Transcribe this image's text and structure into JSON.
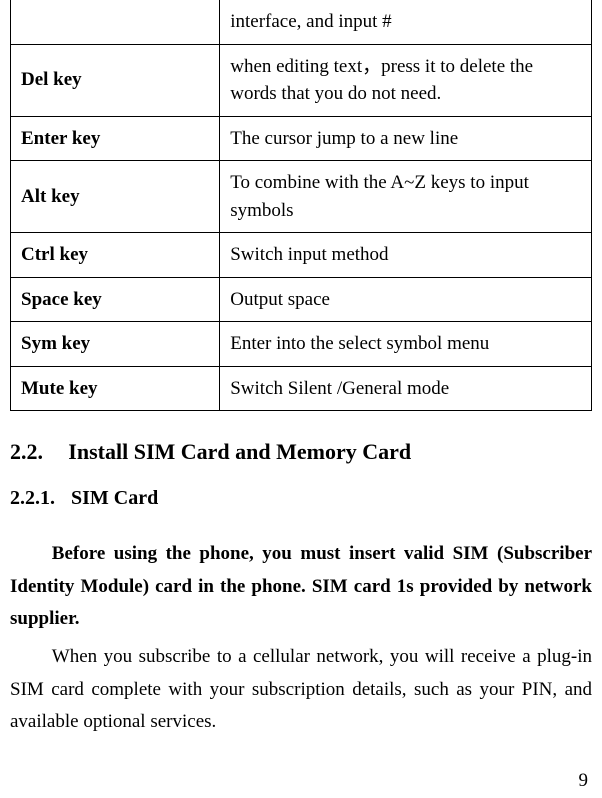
{
  "table": {
    "rows": [
      {
        "key": "",
        "desc": "interface, and input #"
      },
      {
        "key": "Del key",
        "desc": "when editing text，press it to delete the words that you do not need."
      },
      {
        "key": "Enter key",
        "desc": "The cursor jump to a new line"
      },
      {
        "key": "Alt key",
        "desc": "To combine with the A~Z keys to input symbols"
      },
      {
        "key": "Ctrl key",
        "desc": "Switch input method"
      },
      {
        "key": "Space key",
        "desc": "Output space"
      },
      {
        "key": "Sym key",
        "desc": "Enter into the select symbol menu"
      },
      {
        "key": "Mute key",
        "desc": "Switch Silent /General mode"
      }
    ]
  },
  "headings": {
    "h2_num": "2.2.",
    "h2_text": "Install SIM Card and Memory Card",
    "h3_num": "2.2.1.",
    "h3_text": "SIM Card"
  },
  "paragraphs": {
    "p1": "Before using the phone, you must insert valid SIM (Subscriber Identity Module) card in the phone. SIM card 1s provided by network supplier.",
    "p2": "When you subscribe to a cellular network, you will receive a plug-in SIM card complete with your subscription details, such as your PIN, and available optional services."
  },
  "page_number": "9"
}
